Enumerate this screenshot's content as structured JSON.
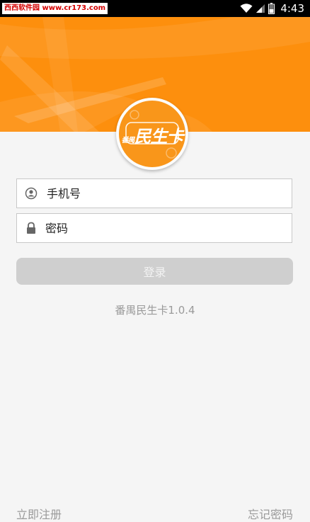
{
  "status_bar": {
    "watermark": "西西软件园 www.cr173.com",
    "time": "4:43",
    "icons": [
      "wifi-icon",
      "signal-icon",
      "battery-icon"
    ]
  },
  "logo": {
    "text": "民生卡",
    "small_text": "番禺"
  },
  "form": {
    "phone_placeholder": "手机号",
    "phone_value": "",
    "password_placeholder": "密码",
    "password_value": "",
    "login_label": "登录"
  },
  "version_text": "番禺民生卡1.0.4",
  "links": {
    "register": "立即注册",
    "forgot_password": "忘记密码"
  },
  "colors": {
    "accent": "#fd8f0d",
    "button_disabled": "#cfcfcf",
    "muted_text": "#9a9a9a"
  }
}
